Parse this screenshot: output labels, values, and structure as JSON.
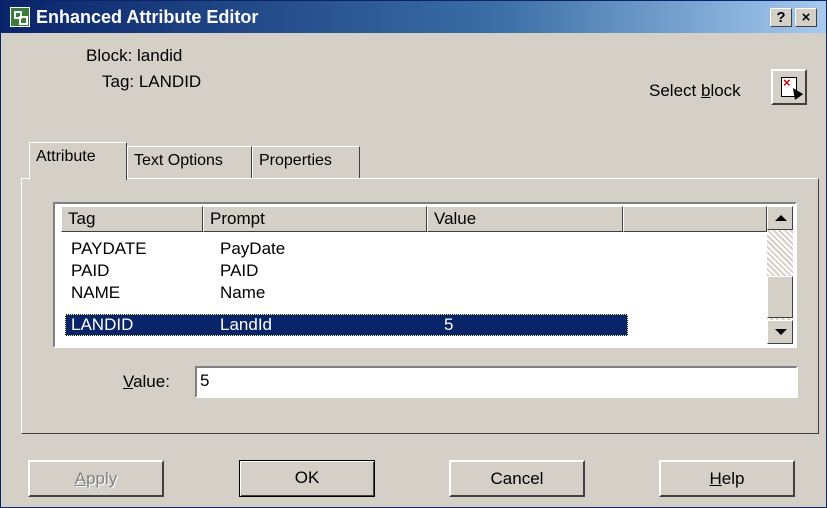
{
  "window": {
    "title": "Enhanced Attribute Editor",
    "help_button": "?",
    "close_button": "×"
  },
  "info": {
    "block_label": "Block: landid",
    "tag_label": "Tag: LANDID",
    "select_block_prefix": "Select ",
    "select_block_underlined": "b",
    "select_block_suffix": "lock"
  },
  "tabs": [
    {
      "label": "Attribute",
      "active": true
    },
    {
      "label": "Text Options",
      "active": false
    },
    {
      "label": "Properties",
      "active": false
    }
  ],
  "table": {
    "columns": [
      "Tag",
      "Prompt",
      "Value"
    ],
    "rows": [
      {
        "tag": "PAYDATE",
        "prompt": "PayDate",
        "value": ""
      },
      {
        "tag": "PAID",
        "prompt": "PAID",
        "value": ""
      },
      {
        "tag": "NAME",
        "prompt": "Name",
        "value": ""
      },
      {
        "tag": "LANDID",
        "prompt": "LandId",
        "value": "5",
        "selected": true
      }
    ]
  },
  "value_field": {
    "label_underlined": "V",
    "label_rest": "alue:",
    "value": "5"
  },
  "buttons": {
    "apply_underlined": "A",
    "apply_rest": "pply",
    "ok": "OK",
    "cancel": "Cancel",
    "help_underlined": "H",
    "help_rest": "elp"
  },
  "colors": {
    "title_bar": "#0a246a",
    "selection": "#0a246a",
    "face": "#d4d0c8"
  }
}
